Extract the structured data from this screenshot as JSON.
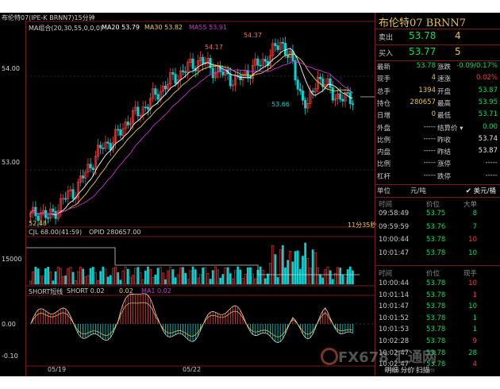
{
  "chart_title": "布伦特07(IPE-K BRNN7)15分钟",
  "indicators_main": {
    "ma_combo": "MA组合(20,30,55,0,0,0)",
    "ma20": "MA20 53.79",
    "ma30": "MA30 53.82",
    "ma55": "MA55 53.91"
  },
  "y_labels": [
    "54.00",
    "53.00",
    "15000",
    "0.00",
    "-0.10"
  ],
  "annotations": [
    "54.37",
    "54.17",
    "53.66",
    "52.48"
  ],
  "time_label": "11分35秒",
  "volume_indicator": {
    "cjl": "CJL 68.00(41:59)",
    "opid": "OPID 280657.00"
  },
  "short_indicator": {
    "name": "SHORT短线",
    "short": "SHORT 0.02",
    "v2": "0.02",
    "ma1": "MA1 0.02"
  },
  "x_labels": [
    "05/19",
    "05/22"
  ],
  "colors": {
    "up": "#ff3b3b",
    "down": "#00d4d4",
    "ma20": "#ffffff",
    "ma30": "#e8d040",
    "ma55": "#d030d0",
    "accent": "#e8c34a",
    "green": "#00e060"
  },
  "panel": {
    "title": "布伦特07  BRNN7",
    "sell": {
      "label": "卖出",
      "price": "53.78",
      "qty": "4"
    },
    "buy": {
      "label": "买入",
      "price": "53.77",
      "qty": "5"
    },
    "stats": [
      {
        "l": "最新",
        "v": "53.78",
        "c": "#00e060",
        "l2": "涨跌",
        "v2": "-0.09/0.17%",
        "c2": "#00e060"
      },
      {
        "l": "现手",
        "v": "4",
        "c": "#e8c34a",
        "l2": "速涨",
        "v2": "0.02%",
        "c2": "#ff3b3b"
      },
      {
        "l": "总手",
        "v": "1394",
        "c": "#e8c34a",
        "l2": "开盘",
        "v2": "53.87",
        "c2": "#00e060"
      },
      {
        "l": "持仓",
        "v": "280657",
        "c": "#e8c34a",
        "l2": "最高",
        "v2": "53.95",
        "c2": "#00e060"
      },
      {
        "l": "日增",
        "v": "0",
        "c": "#e8c34a",
        "l2": "最低",
        "v2": "53.71",
        "c2": "#00e060"
      },
      {
        "l": "外盘",
        "v": "-----",
        "c": "#c8c8c8",
        "l2": "结算价 ▾",
        "v2": "0.00",
        "c2": "#00e060"
      },
      {
        "l": "比例",
        "v": "-----",
        "c": "#c8c8c8",
        "l2": "昨收",
        "v2": "53.74",
        "c2": "#e8e8e8"
      },
      {
        "l": "内盘",
        "v": "-----",
        "c": "#c8c8c8",
        "l2": "昨结",
        "v2": "53.87",
        "c2": "#e8e8e8"
      },
      {
        "l": "比例",
        "v": "-----",
        "c": "#c8c8c8",
        "l2": "涨停",
        "v2": "-----",
        "c2": "#c8c8c8"
      },
      {
        "l": "杠杆",
        "v": "-----",
        "c": "#c8c8c8",
        "l2": "跌停",
        "v2": "-----",
        "c2": "#c8c8c8"
      }
    ],
    "unit_label": "单位",
    "unit_value": "元/吨",
    "currency": "✔ 美元/桶",
    "trade_header": {
      "time": "时间",
      "price": "价位",
      "big": "大单"
    },
    "trades1": [
      {
        "t": "09:58:49",
        "p": "53.75",
        "q": "8",
        "c": "#00e060"
      },
      {
        "t": "09:59:59",
        "p": "53.76",
        "q": "7",
        "c": "#00e060"
      },
      {
        "t": "10:00:44",
        "p": "53.78",
        "q": "10",
        "c": "#ff3b3b"
      },
      {
        "t": "10:01:47",
        "p": "53.78",
        "q": "10",
        "c": "#00e060"
      }
    ],
    "trade_header2": {
      "time": "时间",
      "price": "价位",
      "now": "现手"
    },
    "trades2": [
      {
        "t": "10:00:44",
        "p": "53.78",
        "q": "10",
        "c": "#ff3b3b"
      },
      {
        "t": "10:01:14",
        "p": "53.78",
        "q": "1",
        "c": "#ff3b3b"
      },
      {
        "t": "10:01:47",
        "p": "53.78",
        "q": "10",
        "c": "#00e060"
      },
      {
        "t": "10:01:52",
        "p": "53.78",
        "q": "1",
        "c": "#00e060"
      },
      {
        "t": "10:01:53",
        "p": "53.78",
        "q": "1",
        "c": "#00e060"
      },
      {
        "t": "10:02:28",
        "p": "53.78",
        "q": "9",
        "c": "#ff3b3b"
      },
      {
        "t": "10:02:47",
        "p": "53.78",
        "q": "28",
        "c": "#00e060"
      },
      {
        "t": "10:02:47",
        "p": "53.78",
        "q": "4",
        "c": "#ff3b3b"
      }
    ],
    "bottom_tabs": "明细  分价  扫描"
  },
  "watermark": {
    "brand": "FX678",
    "site": "汇通网",
    "sub": "www.fx678.com"
  },
  "chart_data": {
    "type": "candlestick",
    "price_axis_ticks": [
      54.0,
      53.0
    ],
    "candles_approx_close": [
      52.5,
      52.56,
      52.48,
      52.6,
      52.72,
      52.78,
      52.95,
      53.1,
      53.25,
      53.3,
      53.4,
      53.55,
      53.6,
      53.7,
      53.8,
      53.9,
      53.98,
      54.05,
      54.12,
      54.17,
      54.1,
      54.05,
      54.0,
      53.95,
      54.02,
      54.1,
      54.15,
      54.25,
      54.37,
      54.2,
      53.85,
      53.66,
      54.0,
      53.9,
      53.8,
      53.75,
      53.78
    ]
  }
}
